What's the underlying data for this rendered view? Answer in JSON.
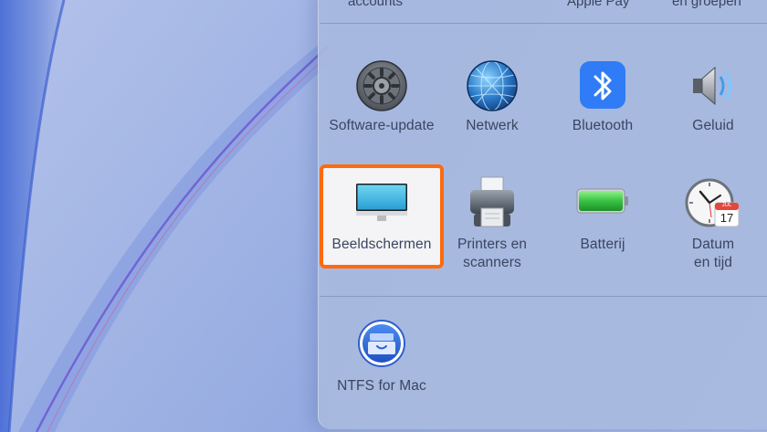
{
  "window": {
    "top_row_partial": [
      "accounts",
      "Apple Pay",
      "en groepen"
    ],
    "row1": [
      {
        "label": "Software-update",
        "icon": "gear-icon"
      },
      {
        "label": "Netwerk",
        "icon": "globe-icon"
      },
      {
        "label": "Bluetooth",
        "icon": "bluetooth-icon"
      },
      {
        "label": "Geluid",
        "icon": "speaker-icon"
      }
    ],
    "row2": [
      {
        "label": "Beeldschermen",
        "icon": "display-icon",
        "highlighted": true
      },
      {
        "label": "Printers en\nscanners",
        "icon": "printer-icon"
      },
      {
        "label": "Batterij",
        "icon": "battery-icon"
      },
      {
        "label": "Datum\nen tijd",
        "icon": "clock-calendar-icon",
        "calendar_month": "JUL",
        "calendar_day": "17"
      }
    ],
    "row3": [
      {
        "label": "NTFS for Mac",
        "icon": "ntfs-drive-icon"
      }
    ]
  },
  "colors": {
    "highlight_border": "#ff6a0f",
    "label_text": "#3a4560",
    "bluetooth_tile": "#2f7cf6",
    "battery_fill": "#39c343"
  }
}
